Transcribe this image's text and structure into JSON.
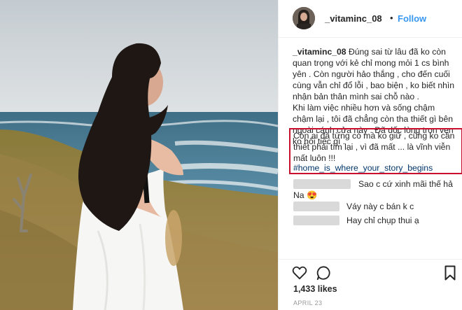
{
  "post": {
    "username": "_vitaminc_08",
    "separator": "•",
    "follow_label": "Follow",
    "caption": {
      "username": "_vitaminc_08",
      "line1": "Đúng sai từ lâu đã ko còn quan trọng với kẻ chỉ mong mỏi 1 cs bình yên . Còn người hảo thắng , cho đến cuối cùng vẫn chỉ đổ lỗi , bao biện , ko biết nhìn nhận bản thân mình sai chỗ nào .",
      "line2": "Khi làm việc nhiều hơn và sống chậm chậm lại , tôi đã chẳng còn tha thiết gì bên ngoài cánh cửa này . Đã dốc lòng trọn vẹn ko hối tiếc gì ."
    },
    "highlight_text": "Còn ai đã từng có mà ko giữ , cũng ko cần thiết phải tìm lại , vì đã mất ... là vĩnh viễn mất luôn !!!",
    "hashtag": "#home_is_where_your_story_begins",
    "comments": [
      {
        "text": "Sao c cứ xinh mãi thế hả"
      },
      {
        "text": "Na 😍"
      },
      {
        "text": "Váy này c bán k c"
      },
      {
        "text": "Hay chỉ chụp thui ạ"
      }
    ],
    "likes": "1,433 likes",
    "date": "APRIL 23"
  },
  "icons": {
    "like": "heart-icon",
    "comment": "comment-bubble-icon",
    "save": "bookmark-icon"
  },
  "colors": {
    "follow": "#3897f0",
    "highlight_border": "#c8102e",
    "hashtag": "#003569"
  }
}
